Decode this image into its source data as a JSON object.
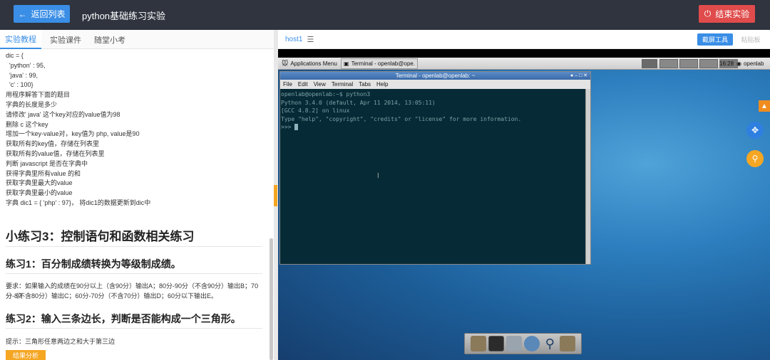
{
  "topbar": {
    "back_label": "返回列表",
    "title": "python基础练习实验",
    "end_label": "结束实验"
  },
  "tabs": [
    "实验教程",
    "实验课件",
    "随堂小考"
  ],
  "code_lines": [
    "dic = {",
    "  'python' : 95,",
    "  'java' : 99,",
    "  'c' : 100}",
    "用程序解答下面的题目",
    "字典的长度是多少",
    "请修改' java' 这个key对应的value值为98",
    "删除 c 这个key",
    "增加一个key-value对，key值为 php, value是90",
    "获取所有的key值，存储在列表里",
    "获取所有的value值，存储在列表里",
    "判断 javascript 是否在字典中",
    "获得字典里所有value 的和",
    "获取字典里最大的value",
    "获取字典里最小的value",
    "字典 dic1 = { 'php' : 97}， 将dic1的数据更新到dic中"
  ],
  "section": {
    "h2": "小练习3：控制语句和函数相关练习",
    "ex1_title": "练习1：百分制成绩转换为等级制成绩。",
    "ex1_req_1": "要求：如果输入的成绩在90分以上（含90分）输出A；80分-90分（不含90分）输出B；70分-80",
    "ex1_req_2": "分（不含80分）输出C；60分-70分（不含70分）输出D；60分以下输出E。",
    "ex2_title": "练习2：输入三条边长，判断是否能构成一个三角形。",
    "ex2_hint": "提示：三角形任意两边之和大于第三边",
    "tag": "结果分析"
  },
  "right": {
    "host_tab": "host1",
    "screenshot": "截屏工具",
    "paste": "粘贴板"
  },
  "desktop": {
    "apps_menu": "Applications Menu",
    "taskbar_window": "Terminal - openlab@ope...",
    "clock": "16:28",
    "user": "openlab",
    "terminal_title": "Terminal - openlab@openlab: ~",
    "menu": [
      "File",
      "Edit",
      "View",
      "Terminal",
      "Tabs",
      "Help"
    ],
    "lines": [
      "openlab@openlab:~$ python3",
      "Python 3.4.0 (default, Apr 11 2014, 13:05:11)",
      "[GCC 4.8.2] on linux",
      "Type \"help\", \"copyright\", \"credits\" or \"license\" for more information.",
      ">>> "
    ]
  },
  "colors": {
    "primary": "#3a8ee6",
    "danger": "#e04b4b",
    "accent": "#f5a623"
  }
}
